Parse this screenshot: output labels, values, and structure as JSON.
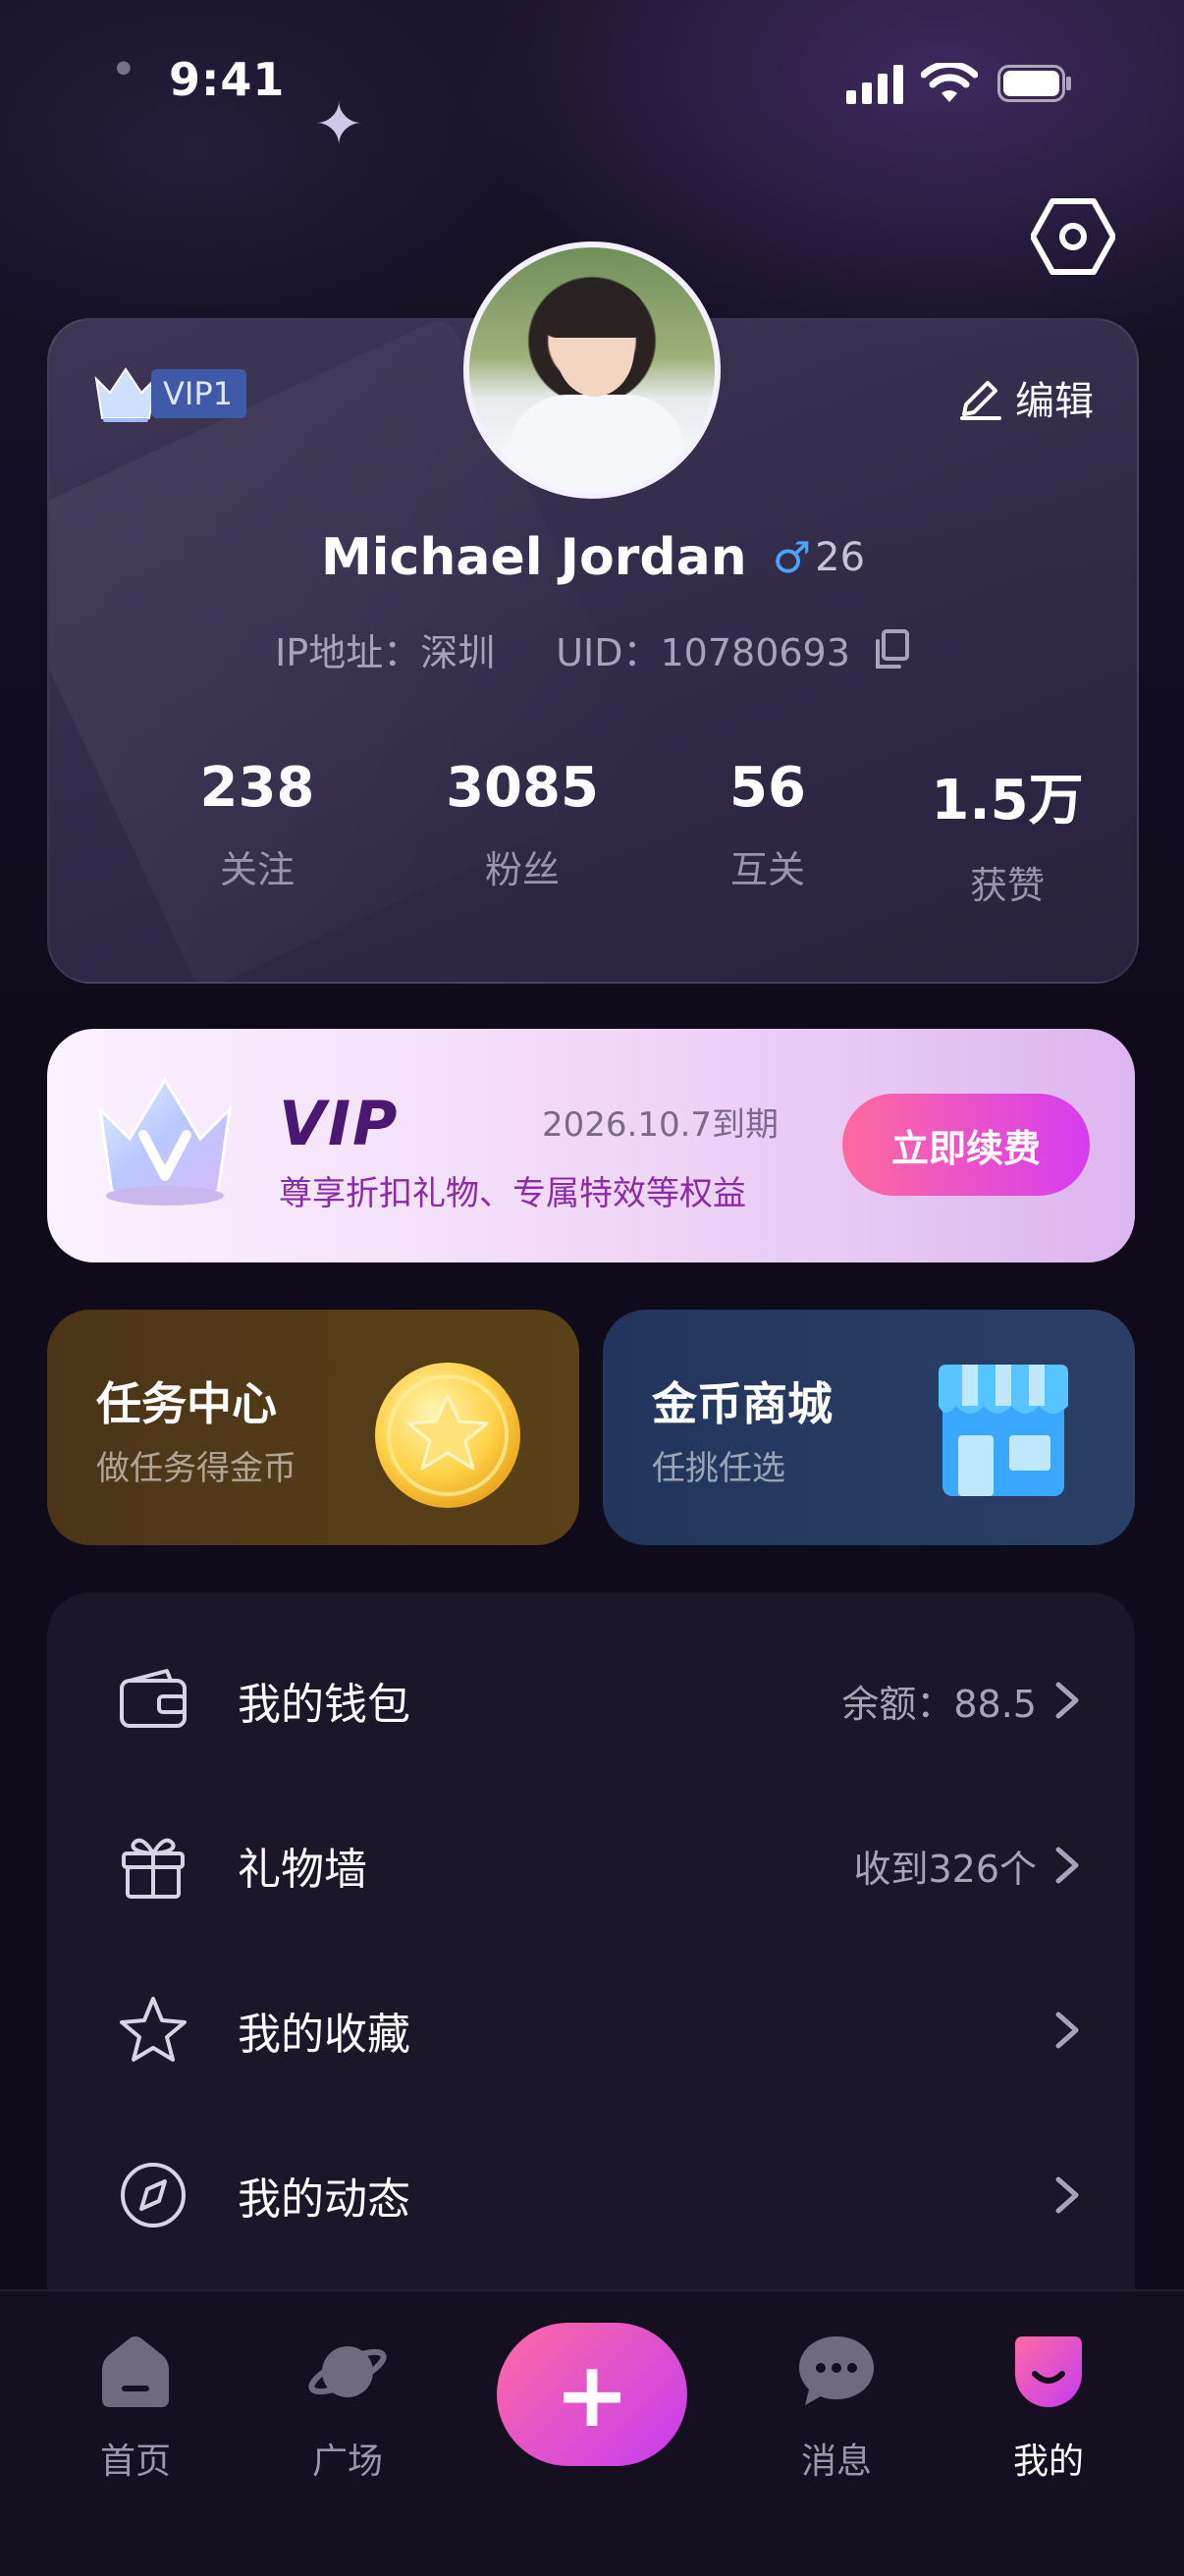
{
  "status_bar": {
    "time": "9:41"
  },
  "profile": {
    "vip_level": "VIP1",
    "edit_label": "编辑",
    "name": "Michael Jordan",
    "gender_symbol": "♂",
    "age": "26",
    "ip": "IP地址：深圳",
    "uid": "UID：10780693",
    "stats": [
      {
        "value": "238",
        "label": "关注"
      },
      {
        "value": "3085",
        "label": "粉丝"
      },
      {
        "value": "56",
        "label": "互关"
      },
      {
        "value": "1.5万",
        "label": "获赞"
      }
    ]
  },
  "vip_banner": {
    "title": "VIP",
    "expire": "2026.10.7到期",
    "desc": "尊享折扣礼物、专属特效等权益",
    "button": "立即续费"
  },
  "features": [
    {
      "title": "任务中心",
      "subtitle": "做任务得金币"
    },
    {
      "title": "金币商城",
      "subtitle": "任挑任选"
    }
  ],
  "menu": [
    {
      "label": "我的钱包",
      "value": "余额：88.5",
      "icon": "wallet-icon"
    },
    {
      "label": "礼物墙",
      "value": "收到326个",
      "icon": "gift-icon"
    },
    {
      "label": "我的收藏",
      "value": "",
      "icon": "star-icon"
    },
    {
      "label": "我的动态",
      "value": "",
      "icon": "compass-icon"
    }
  ],
  "tabs": [
    {
      "label": "首页",
      "icon": "home-icon"
    },
    {
      "label": "广场",
      "icon": "planet-icon"
    },
    {
      "label": "+",
      "icon": "plus-icon"
    },
    {
      "label": "消息",
      "icon": "chat-icon"
    },
    {
      "label": "我的",
      "icon": "profile-icon"
    }
  ],
  "colors": {
    "accent": "#d63cf0",
    "accent2": "#ff6a9e",
    "background": "#0f0b1a"
  }
}
